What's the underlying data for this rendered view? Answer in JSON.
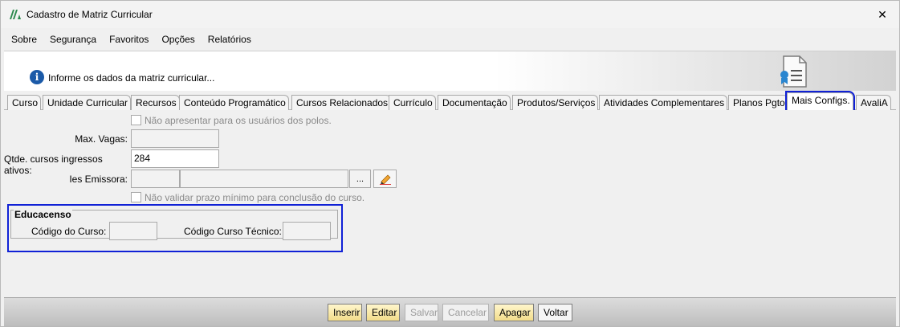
{
  "window": {
    "title": "Cadastro de Matriz Curricular",
    "close_glyph": "✕"
  },
  "menu": [
    {
      "label": "Sobre"
    },
    {
      "label": "Segurança"
    },
    {
      "label": "Favoritos"
    },
    {
      "label": "Opções"
    },
    {
      "label": "Relatórios"
    }
  ],
  "header": {
    "info_glyph": "i",
    "message": "Informe os dados da matriz curricular..."
  },
  "tabs": [
    {
      "label": "Curso"
    },
    {
      "label": "Unidade Curricular"
    },
    {
      "label": "Recursos"
    },
    {
      "label": "Conteúdo Programático"
    },
    {
      "label": "Cursos Relacionados"
    },
    {
      "label": "Currículo"
    },
    {
      "label": "Documentação"
    },
    {
      "label": "Produtos/Serviços"
    },
    {
      "label": "Atividades Complementares"
    },
    {
      "label": "Planos Pgto"
    },
    {
      "label": "Mais Configs."
    },
    {
      "label": "AvaliA"
    }
  ],
  "active_tab": "Mais Configs.",
  "form": {
    "nao_apresentar_label": "Não apresentar para os usuários dos polos.",
    "max_vagas_label": "Max. Vagas:",
    "max_vagas_value": "",
    "qtde_label": "Qtde. cursos ingressos ativos:",
    "qtde_value": "284",
    "ies_label": "Ies Emissora:",
    "ies_code_value": "",
    "ies_name_value": "",
    "browse_label": "...",
    "nao_validar_label": "Não validar prazo mínimo para conclusão do curso."
  },
  "educacenso": {
    "title": "Educacenso",
    "codigo_curso_label": "Código do Curso:",
    "codigo_curso_value": "",
    "codigo_tecnico_label": "Código Curso Técnico:",
    "codigo_tecnico_value": ""
  },
  "actions": {
    "inserir": "Inserir",
    "editar": "Editar",
    "salvar": "Salvar",
    "cancelar": "Cancelar",
    "apagar": "Apagar",
    "voltar": "Voltar"
  },
  "colors": {
    "highlight": "#1021d6",
    "info_blue": "#1b5aa8",
    "button_yellow": "#f2dc8a"
  }
}
